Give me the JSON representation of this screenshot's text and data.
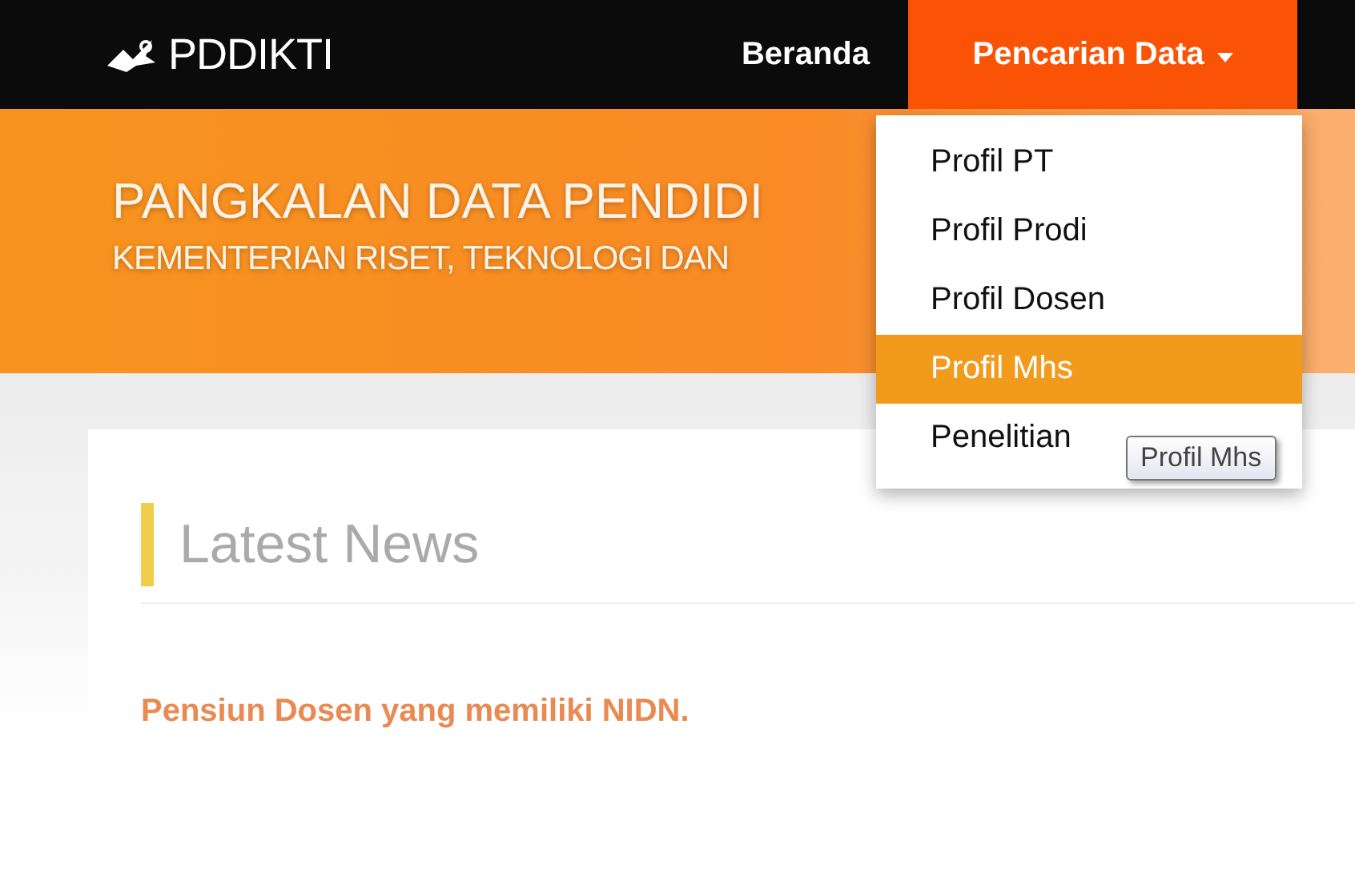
{
  "header": {
    "logo": "PDDIKTI",
    "nav": [
      {
        "label": "Beranda",
        "selected": false,
        "dropdown": false
      },
      {
        "label": "Pencarian Data",
        "selected": true,
        "dropdown": true
      }
    ]
  },
  "menu": {
    "items": [
      {
        "label": "Profil PT",
        "selected": false
      },
      {
        "label": "Profil Prodi",
        "selected": false
      },
      {
        "label": "Profil Dosen",
        "selected": false
      },
      {
        "label": "Profil Mhs",
        "selected": true
      },
      {
        "label": "Penelitian",
        "selected": false
      }
    ]
  },
  "tooltip": "Profil Mhs",
  "banner": {
    "title": "PANGKALAN DATA PENDIDI",
    "subtitle": "KEMENTERIAN RISET, TEKNOLOGI DAN"
  },
  "news": {
    "heading": "Latest News",
    "items": [
      "Pensiun Dosen yang memiliki NIDN."
    ]
  }
}
